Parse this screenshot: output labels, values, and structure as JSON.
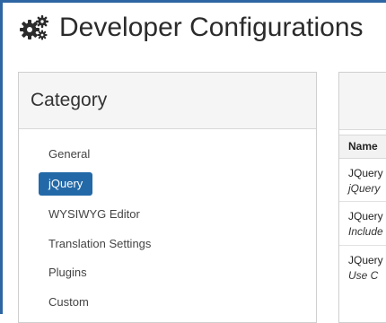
{
  "page": {
    "title": "Developer Configurations"
  },
  "category": {
    "heading": "Category",
    "items": [
      {
        "label": "General",
        "active": false
      },
      {
        "label": "jQuery",
        "active": true
      },
      {
        "label": "WYSIWYG Editor",
        "active": false
      },
      {
        "label": "Translation Settings",
        "active": false
      },
      {
        "label": "Plugins",
        "active": false
      },
      {
        "label": "Custom",
        "active": false
      }
    ]
  },
  "settings": {
    "name_header": "Name",
    "rows": [
      {
        "name": "JQuery",
        "desc": "jQuery"
      },
      {
        "name": "JQuery",
        "desc": "Include"
      },
      {
        "name": "JQuery",
        "desc": "Use C"
      }
    ]
  },
  "colors": {
    "accent": "#2369a8",
    "frame": "#2d66a3"
  }
}
